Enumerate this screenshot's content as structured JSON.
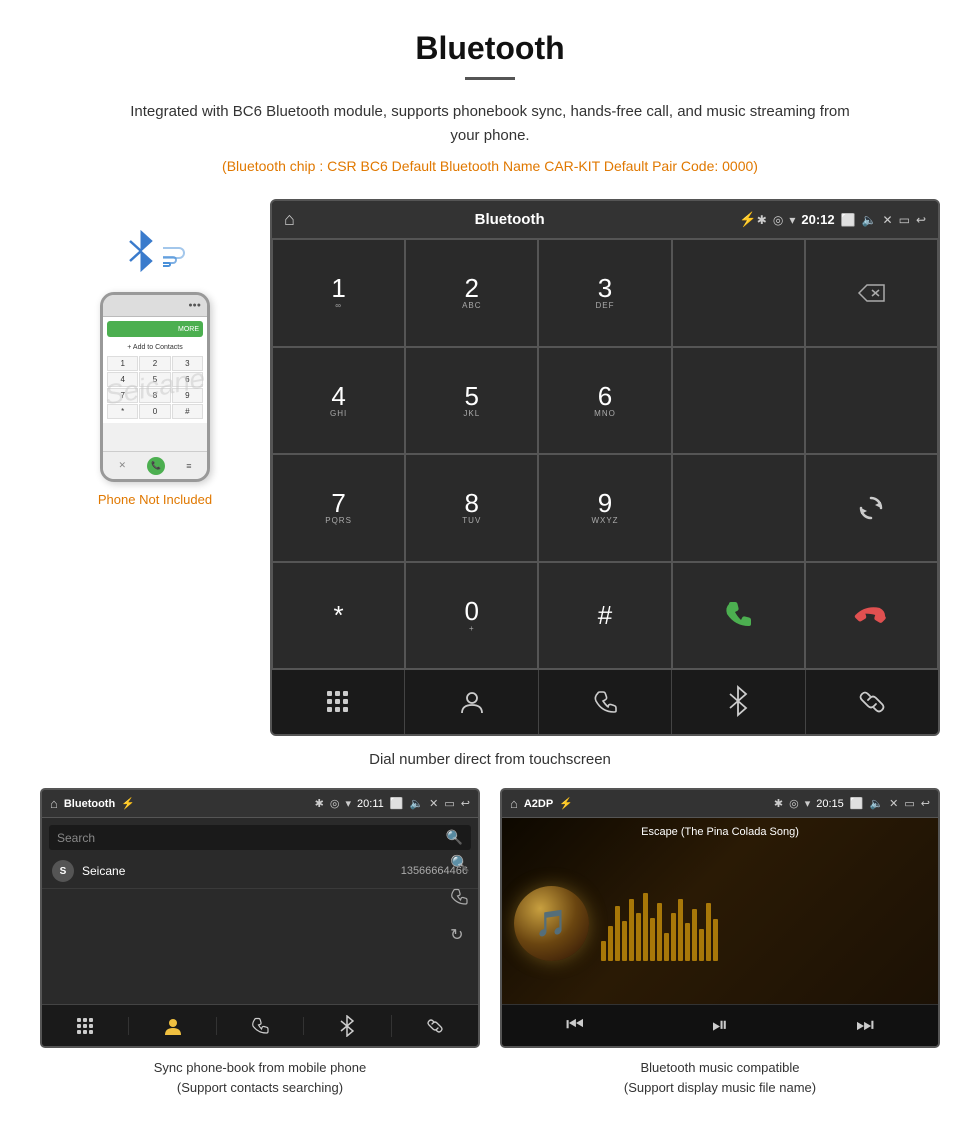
{
  "page": {
    "title": "Bluetooth",
    "divider": true,
    "description": "Integrated with BC6 Bluetooth module, supports phonebook sync, hands-free call, and music streaming from your phone.",
    "specs": "(Bluetooth chip : CSR BC6    Default Bluetooth Name CAR-KIT    Default Pair Code: 0000)",
    "dial_caption": "Dial number direct from touchscreen",
    "sync_caption_line1": "Sync phone-book from mobile phone",
    "sync_caption_line2": "(Support contacts searching)",
    "music_caption_line1": "Bluetooth music compatible",
    "music_caption_line2": "(Support display music file name)"
  },
  "phone_aside": {
    "not_included_label": "Phone Not Included",
    "watermark": "Seicane"
  },
  "car_screen_main": {
    "header": {
      "title": "Bluetooth",
      "time": "20:12"
    },
    "dialpad": [
      {
        "number": "1",
        "letters": "∞"
      },
      {
        "number": "2",
        "letters": "ABC"
      },
      {
        "number": "3",
        "letters": "DEF"
      },
      {
        "number": "",
        "letters": ""
      },
      {
        "number": "⌫",
        "letters": ""
      },
      {
        "number": "4",
        "letters": "GHI"
      },
      {
        "number": "5",
        "letters": "JKL"
      },
      {
        "number": "6",
        "letters": "MNO"
      },
      {
        "number": "",
        "letters": ""
      },
      {
        "number": "",
        "letters": ""
      },
      {
        "number": "7",
        "letters": "PQRS"
      },
      {
        "number": "8",
        "letters": "TUV"
      },
      {
        "number": "9",
        "letters": "WXYZ"
      },
      {
        "number": "",
        "letters": ""
      },
      {
        "number": "↻",
        "letters": ""
      },
      {
        "number": "*",
        "letters": ""
      },
      {
        "number": "0",
        "letters": "+"
      },
      {
        "number": "#",
        "letters": ""
      },
      {
        "number": "📞",
        "letters": ""
      },
      {
        "number": "📵",
        "letters": ""
      }
    ],
    "bottom_nav": [
      "⠿",
      "👤",
      "📞",
      "✱",
      "🔗"
    ]
  },
  "contacts_screen": {
    "header": {
      "title": "Bluetooth",
      "time": "20:11"
    },
    "search_placeholder": "Search",
    "contacts": [
      {
        "initial": "S",
        "name": "Seicane",
        "phone": "13566664466"
      }
    ],
    "bottom_nav": [
      "⠿",
      "👤",
      "📞",
      "✱",
      "🔗"
    ]
  },
  "music_screen": {
    "header": {
      "title": "A2DP",
      "time": "20:15"
    },
    "track": "Escape (The Pina Colada Song)",
    "eq_bars": [
      20,
      35,
      55,
      40,
      65,
      50,
      70,
      45,
      60,
      30,
      50,
      65,
      40,
      55,
      35,
      60,
      45,
      70,
      35,
      50
    ],
    "controls": [
      "⏮",
      "⏯",
      "⏭"
    ]
  },
  "colors": {
    "orange": "#e07800",
    "blue": "#3a7bcc",
    "green": "#4caf50",
    "red": "#e05050",
    "dark_bg": "#2a2a2a",
    "header_bg": "#333"
  }
}
